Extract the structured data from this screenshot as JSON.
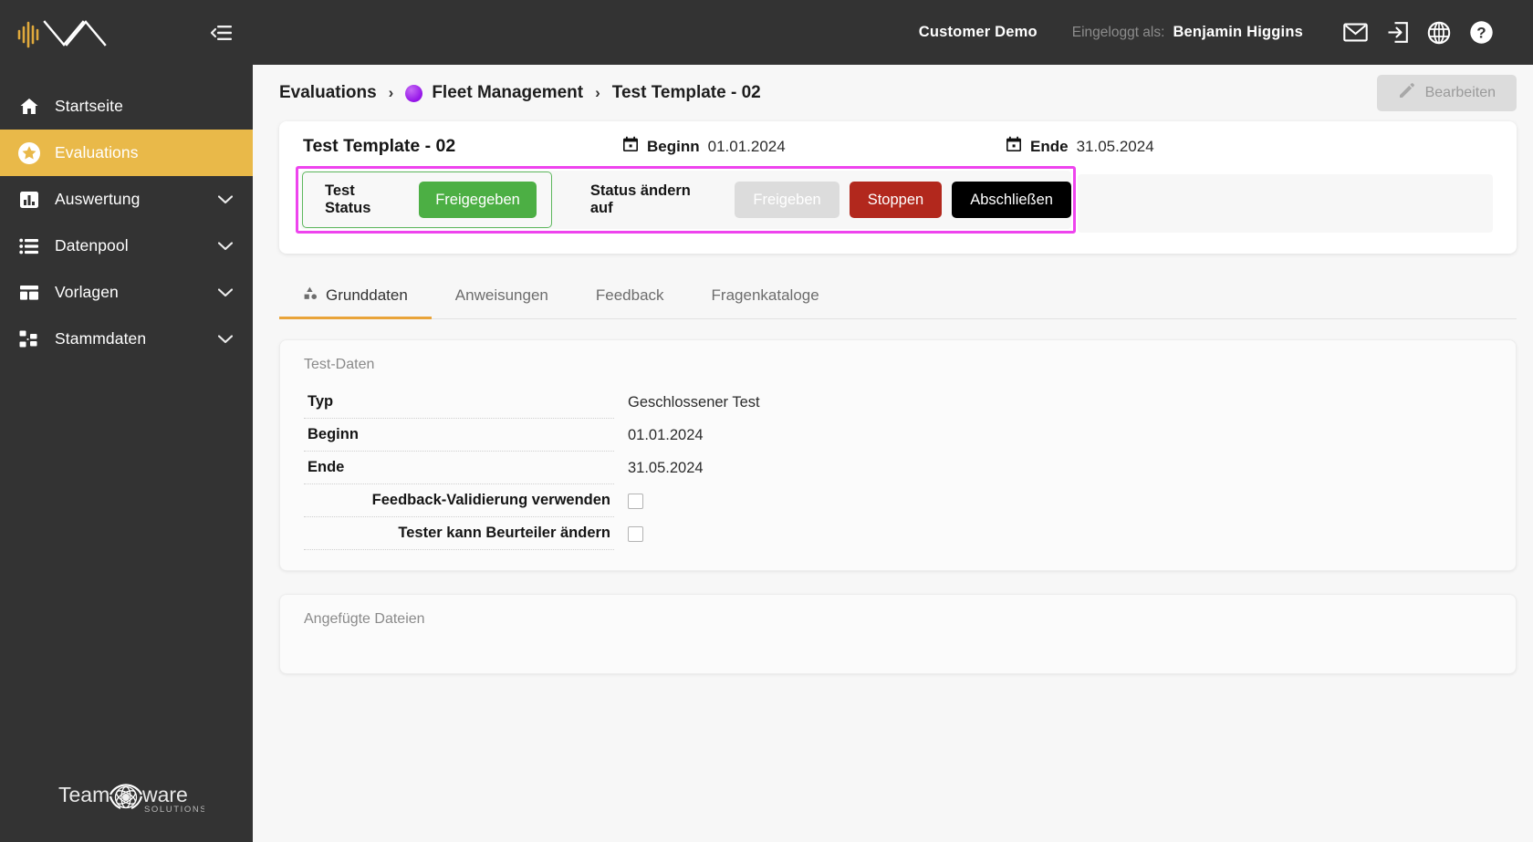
{
  "sidebar": {
    "logo_name": "mva-waveform-logo",
    "collapse_icon": "collapse-sidebar-icon",
    "items": [
      {
        "label": "Startseite",
        "icon": "home-icon",
        "active": false,
        "expandable": false
      },
      {
        "label": "Evaluations",
        "icon": "star-icon",
        "active": true,
        "expandable": false
      },
      {
        "label": "Auswertung",
        "icon": "bar-chart-icon",
        "active": false,
        "expandable": true
      },
      {
        "label": "Datenpool",
        "icon": "list-icon",
        "active": false,
        "expandable": true
      },
      {
        "label": "Vorlagen",
        "icon": "layout-icon",
        "active": false,
        "expandable": true
      },
      {
        "label": "Stammdaten",
        "icon": "hierarchy-icon",
        "active": false,
        "expandable": true
      }
    ],
    "footer_logo": {
      "text_left": "Team",
      "text_right": "ware",
      "subtext": "SOLUTIONS"
    }
  },
  "topbar": {
    "customer": "Customer Demo",
    "logged_in_label": "Eingeloggt als:",
    "username": "Benjamin Higgins",
    "icons": [
      "mail-icon",
      "logout-icon",
      "globe-icon",
      "help-icon"
    ]
  },
  "breadcrumb": {
    "item1": "Evaluations",
    "separator": "›",
    "item2": "Fleet Management",
    "item2_dot_color": "#a020f0",
    "item3": "Test Template - 02"
  },
  "edit_button": {
    "label": "Bearbeiten",
    "icon": "pencil-icon",
    "disabled": true
  },
  "status_card": {
    "title": "Test Template - 02",
    "begin": {
      "label": "Beginn",
      "value": "01.01.2024",
      "icon": "calendar-icon"
    },
    "end": {
      "label": "Ende",
      "value": "31.05.2024",
      "icon": "calendar-icon"
    },
    "status_label": "Test Status",
    "status_value": "Freigegeben",
    "status_color": "#4caf44",
    "change_label": "Status ändern auf",
    "actions": [
      {
        "label": "Freigeben",
        "state": "disabled",
        "color": "#dcdcdc"
      },
      {
        "label": "Stoppen",
        "state": "enabled",
        "color": "#b2281d"
      },
      {
        "label": "Abschließen",
        "state": "enabled",
        "color": "#000000"
      }
    ],
    "highlight_color": "#ee44ee"
  },
  "tabs": [
    {
      "label": "Grunddaten",
      "icon": "shapes-icon",
      "active": true
    },
    {
      "label": "Anweisungen",
      "icon": "",
      "active": false
    },
    {
      "label": "Feedback",
      "icon": "",
      "active": false
    },
    {
      "label": "Fragenkataloge",
      "icon": "",
      "active": false
    }
  ],
  "test_data": {
    "panel_title": "Test-Daten",
    "rows": [
      {
        "key": "Typ",
        "value": "Geschlossener Test",
        "type": "text"
      },
      {
        "key": "Beginn",
        "value": "01.01.2024",
        "type": "text"
      },
      {
        "key": "Ende",
        "value": "31.05.2024",
        "type": "text"
      },
      {
        "key": "Feedback-Validierung verwenden",
        "value": "",
        "type": "checkbox",
        "checked": false
      },
      {
        "key": "Tester kann Beurteiler ändern",
        "value": "",
        "type": "checkbox",
        "checked": false
      }
    ]
  },
  "files_panel": {
    "panel_title": "Angefügte Dateien"
  }
}
